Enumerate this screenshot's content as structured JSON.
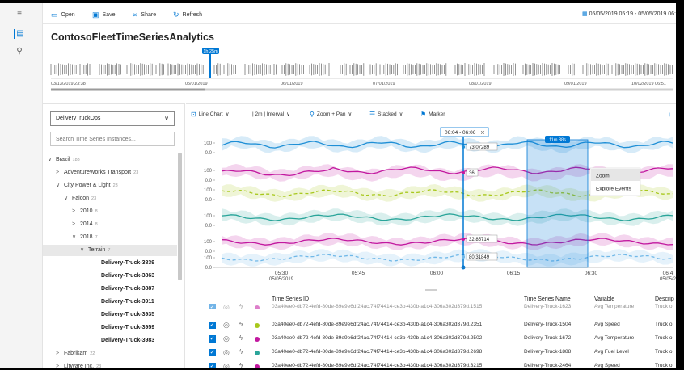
{
  "toolbar": {
    "open_label": "Open",
    "save_label": "Save",
    "share_label": "Share",
    "refresh_label": "Refresh",
    "date_range": "05/05/2019 05:19 - 05/05/2019 06:"
  },
  "environment_title": "ContosoFleetTimeSeriesAnalytics",
  "availability": {
    "selection_badge": "1h 25m",
    "dates": [
      "03/13/2019 23:38",
      "05/01/2019",
      "06/01/2019",
      "07/01/2019",
      "08/01/2019",
      "09/01/2019",
      "10/02/2019 06:51"
    ]
  },
  "left_panel": {
    "hierarchy_select": "DeliveryTruckOps",
    "search_placeholder": "Search Time Series Instances...",
    "tree": [
      {
        "label": "Brazil",
        "count": "183",
        "arrow": "∨"
      },
      {
        "label": "AdventureWorks Transport",
        "count": "23",
        "arrow": ">"
      },
      {
        "label": "City Power & Light",
        "count": "23",
        "arrow": "∨"
      },
      {
        "label": "Falcon",
        "count": "23",
        "arrow": "∨"
      },
      {
        "label": "2010",
        "count": "8",
        "arrow": ">"
      },
      {
        "label": "2014",
        "count": "8",
        "arrow": ">"
      },
      {
        "label": "2018",
        "count": "7",
        "arrow": "∨"
      },
      {
        "label": "Terrain",
        "count": "7",
        "arrow": "∨"
      },
      {
        "label": "Delivery-Truck-3839",
        "count": "",
        "arrow": ""
      },
      {
        "label": "Delivery-Truck-3863",
        "count": "",
        "arrow": ""
      },
      {
        "label": "Delivery-Truck-3887",
        "count": "",
        "arrow": ""
      },
      {
        "label": "Delivery-Truck-3911",
        "count": "",
        "arrow": ""
      },
      {
        "label": "Delivery-Truck-3935",
        "count": "",
        "arrow": ""
      },
      {
        "label": "Delivery-Truck-3959",
        "count": "",
        "arrow": ""
      },
      {
        "label": "Delivery-Truck-3983",
        "count": "",
        "arrow": ""
      },
      {
        "label": "Fabrikam",
        "count": "22",
        "arrow": ">"
      },
      {
        "label": "LitWare Inc.",
        "count": "23",
        "arrow": ">"
      }
    ]
  },
  "chart_toolbar": {
    "line_chart": "Line Chart",
    "interval": "| 2m | Interval",
    "zoom_pan": "Zoom + Pan",
    "stacked": "Stacked",
    "marker": "Marker"
  },
  "chart": {
    "marker_label": "06:04 - 06:06",
    "brush_label": "11m 38s",
    "context_menu": [
      "Zoom",
      "Explore Events"
    ],
    "marker_values": [
      "73.07289",
      "36",
      "32.85714",
      "80.31849"
    ],
    "x_ticks": [
      {
        "label": "05:30",
        "sub": "05/05/2019"
      },
      {
        "label": "05:45",
        "sub": ""
      },
      {
        "label": "06:00",
        "sub": ""
      },
      {
        "label": "06:15",
        "sub": ""
      },
      {
        "label": "06:30",
        "sub": ""
      },
      {
        "label": "06:4",
        "sub": "05/05/2"
      }
    ],
    "y_ticks": [
      "100",
      "0.0",
      "100",
      "0.0",
      "100",
      "0.0",
      "100",
      "0.0",
      "100",
      "0.0",
      "100",
      "0.0"
    ],
    "series_colors": [
      "#1f8fd6",
      "#c2189f",
      "#a8c81c",
      "#2aa59a",
      "#c2189f",
      "#70b8e8"
    ]
  },
  "grid": {
    "headers": {
      "id": "Time Series ID",
      "name": "Time Series Name",
      "variable": "Variable",
      "desc": "Descrip"
    },
    "rows": [
      {
        "id": "03a40ee0-db72-4efd-80de-89e9e6df24ac.74f74414-ce3b-430b-a1c4-306a302d379d.1515",
        "name": "Delivery-Truck-1623",
        "variable": "Avg Temperature",
        "desc": "Truck o",
        "color": "#c2189f"
      },
      {
        "id": "03a40ee0-db72-4efd-80de-89e9e6df24ac.74f74414-ce3b-430b-a1c4-306a302d379d.2351",
        "name": "Delivery-Truck-1504",
        "variable": "Avg Speed",
        "desc": "Truck o",
        "color": "#a8c81c"
      },
      {
        "id": "03a40ee0-db72-4efd-80de-89e9e6df24ac.74f74414-ce3b-430b-a1c4-306a302d379d.2502",
        "name": "Delivery-Truck-1672",
        "variable": "Avg Temperature",
        "desc": "Truck o",
        "color": "#c2189f"
      },
      {
        "id": "03a40ee0-db72-4efd-80de-89e9e6df24ac.74f74414-ce3b-430b-a1c4-306a302d379d.2698",
        "name": "Delivery-Truck-1888",
        "variable": "Avg Fuel Level",
        "desc": "Truck o",
        "color": "#2aa59a"
      },
      {
        "id": "03a40ee0-db72-4efd-80de-89e9e6df24ac.74f74414-ce3b-430b-a1c4-306a302d379d.3215",
        "name": "Delivery-Truck-2464",
        "variable": "Avg Speed",
        "desc": "Truck o",
        "color": "#c2189f"
      }
    ]
  }
}
